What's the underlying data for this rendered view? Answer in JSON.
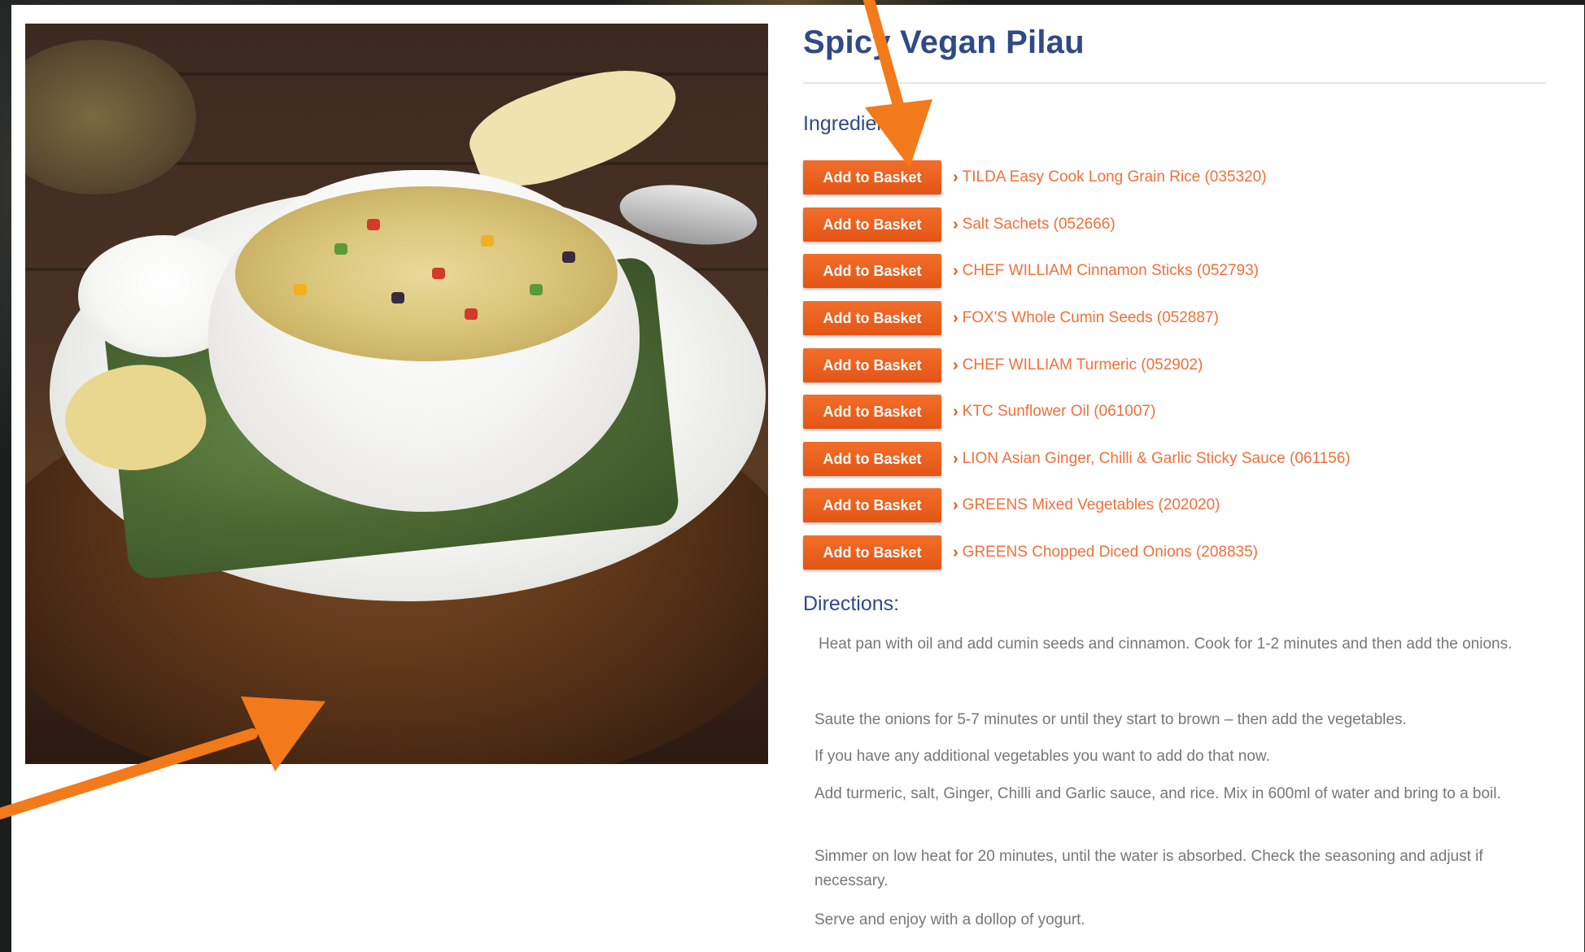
{
  "recipe": {
    "title": "Spicy Vegan Pilau",
    "ingredients_label": "Ingredients:",
    "button_label": "Add to Basket",
    "ingredients": [
      "TILDA Easy Cook Long Grain Rice (035320)",
      "Salt Sachets (052666)",
      "CHEF WILLIAM Cinnamon Sticks (052793)",
      "FOX'S Whole Cumin Seeds (052887)",
      "CHEF WILLIAM Turmeric (052902)",
      "KTC Sunflower Oil (061007)",
      "LION Asian Ginger, Chilli & Garlic Sticky Sauce (061156)",
      "GREENS Mixed Vegetables (202020)",
      "GREENS Chopped Diced Onions (208835)"
    ],
    "directions_label": "Directions:",
    "directions": [
      "Heat pan with oil and add cumin seeds and cinnamon. Cook for 1-2 minutes and then add the onions.",
      "Saute the onions for 5-7 minutes or until they start to brown – then add the vegetables.",
      "If you have any additional vegetables you want to add do that now.",
      "Add turmeric, salt, Ginger, Chilli and Garlic sauce, and rice. Mix in 600ml of water and bring to a boil.",
      "Simmer on low heat for 20 minutes, until the water is absorbed. Check the seasoning and adjust if necessary.",
      "Serve and enjoy with a dollop of yogurt."
    ]
  },
  "icons": {
    "ingredient_link": "chevron-right-icon",
    "annotation": "arrow-icon"
  },
  "colors": {
    "title": "#2f4a85",
    "button": "#e8581c",
    "link": "#f0703b",
    "annotation_arrow": "#f27a1a"
  }
}
